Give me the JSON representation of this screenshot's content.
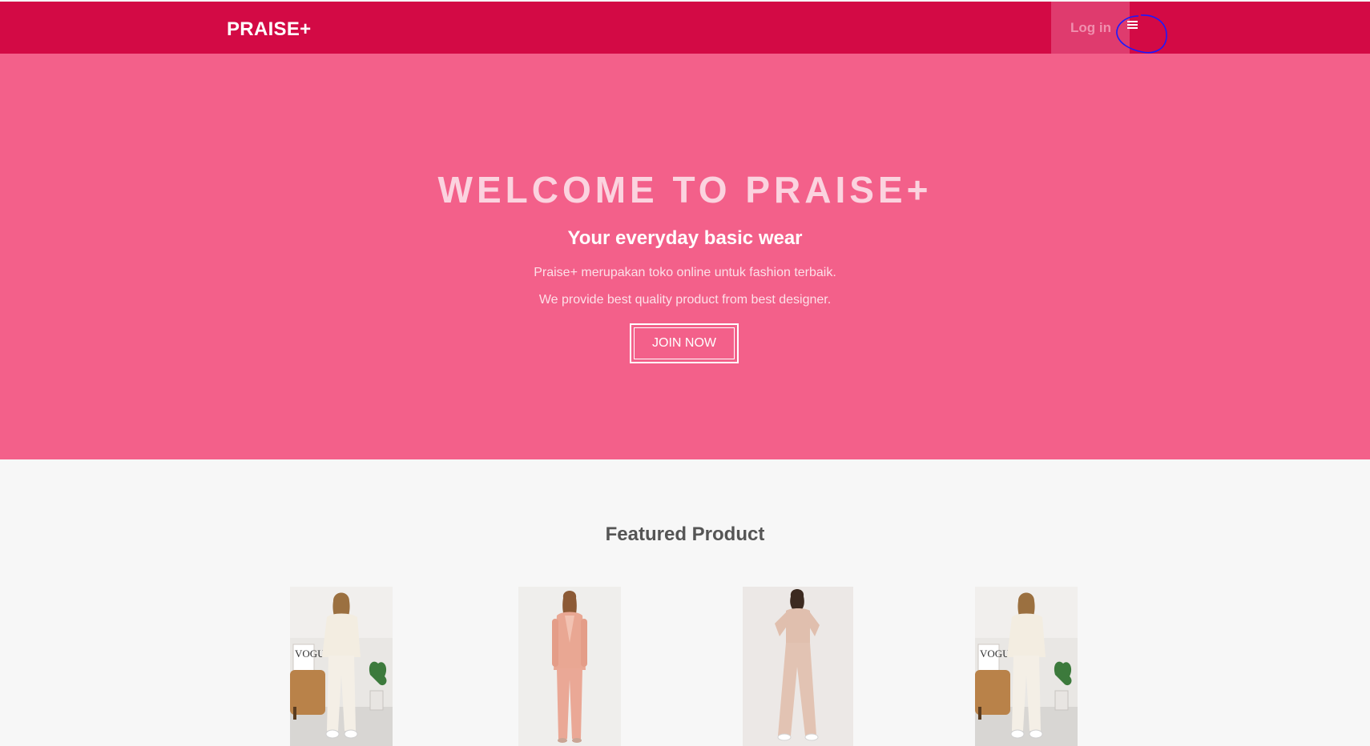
{
  "navbar": {
    "brand": "PRAISE+",
    "login_label": "Log in",
    "menu_icon": "hamburger-menu-icon"
  },
  "hero": {
    "title": "WELCOME TO PRAISE+",
    "subtitle": "Your everyday basic wear",
    "line1": "Praise+ merupakan toko online untuk fashion terbaik.",
    "line2": "We provide best quality product from best designer.",
    "cta_label": "JOIN NOW"
  },
  "featured": {
    "title": "Featured Product",
    "products": [
      {
        "image": "cream-knit-outfit-photo"
      },
      {
        "image": "pink-blazer-suit-photo"
      },
      {
        "image": "nude-top-pants-photo"
      },
      {
        "image": "cream-knit-outfit-photo"
      }
    ]
  },
  "colors": {
    "navbar": "#d30a45",
    "login_bg": "#df3b6e",
    "hero": "#f3608a",
    "hero_title": "#fbd3df",
    "page_bg": "#f7f7f7",
    "annotation": "#1a1aff"
  }
}
